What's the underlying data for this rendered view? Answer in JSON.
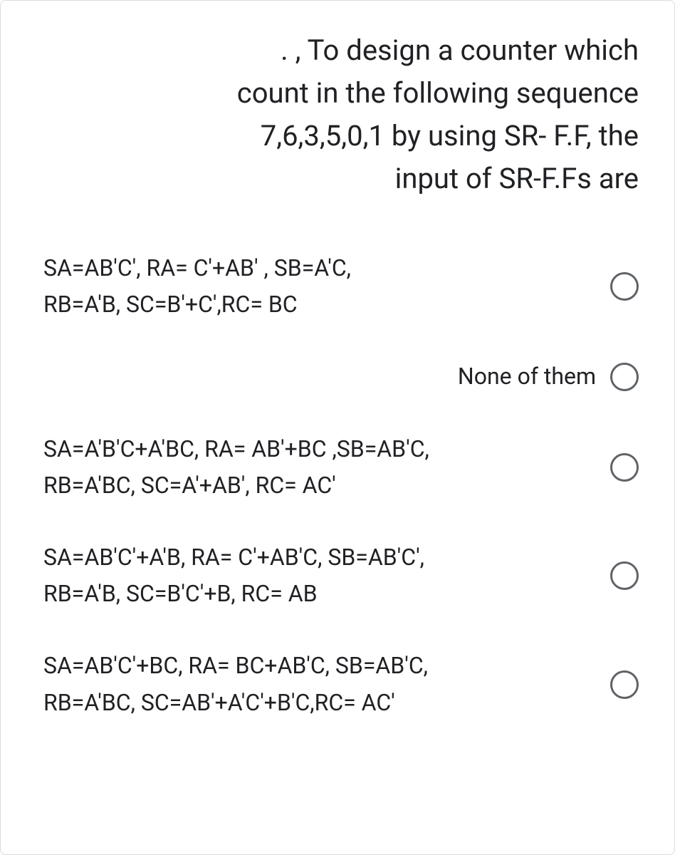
{
  "question": {
    "line1": ". , To design a counter which",
    "line2": "count in the following sequence",
    "line3": "7,6,3,5,0,1 by using SR- F.F, the",
    "line4": "input of SR-F.Fs are"
  },
  "options": [
    {
      "line1": "SA=AB'C', RA= C'+AB' , SB=A'C,",
      "line2": "RB=A'B, SC=B'+C',RC= BC",
      "align": "left"
    },
    {
      "line1": "None of them",
      "line2": "",
      "align": "right"
    },
    {
      "line1": "SA=A'B'C+A'BC, RA= AB'+BC ,SB=AB'C,",
      "line2": "RB=A'BC, SC=A'+AB', RC= AC'",
      "align": "left"
    },
    {
      "line1": "SA=AB'C'+A'B, RA= C'+AB'C, SB=AB'C',",
      "line2": "RB=A'B, SC=B'C'+B, RC= AB",
      "align": "left"
    },
    {
      "line1": "SA=AB'C'+BC, RA= BC+AB'C, SB=AB'C,",
      "line2": "RB=A'BC, SC=AB'+A'C'+B'C,RC= AC'",
      "align": "left"
    }
  ]
}
